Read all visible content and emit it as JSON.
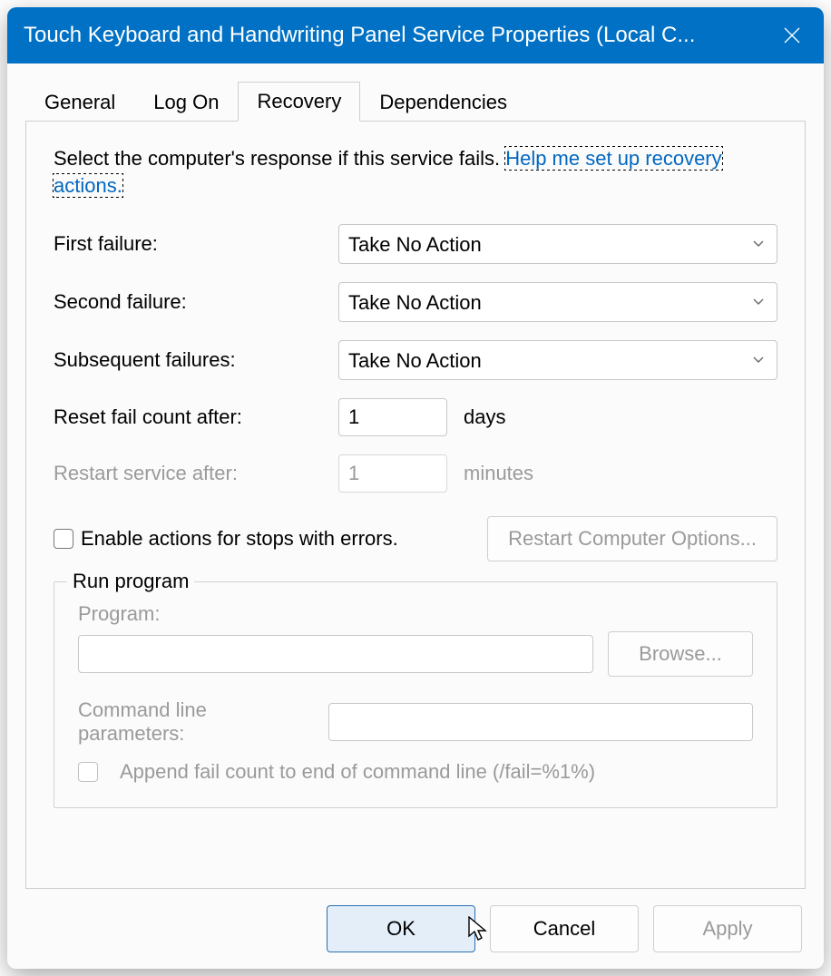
{
  "title": "Touch Keyboard and Handwriting Panel Service Properties (Local C...",
  "tabs": {
    "general": "General",
    "logon": "Log On",
    "recovery": "Recovery",
    "dependencies": "Dependencies"
  },
  "intro": "Select the computer's response if this service fails.",
  "help_link": "Help me set up recovery actions.",
  "labels": {
    "first_failure": "First failure:",
    "second_failure": "Second failure:",
    "subsequent_failures": "Subsequent failures:",
    "reset_after": "Reset fail count after:",
    "restart_after": "Restart service after:",
    "days": "days",
    "minutes": "minutes",
    "enable_actions": "Enable actions for stops with errors.",
    "restart_options": "Restart Computer Options...",
    "run_program": "Run program",
    "program": "Program:",
    "browse": "Browse...",
    "cmd_params": "Command line parameters:",
    "append": "Append fail count to end of command line (/fail=%1%)"
  },
  "selects": {
    "first": "Take No Action",
    "second": "Take No Action",
    "subsequent": "Take No Action"
  },
  "values": {
    "reset_days": "1",
    "restart_minutes": "1",
    "program_path": "",
    "cmd_params": ""
  },
  "buttons": {
    "ok": "OK",
    "cancel": "Cancel",
    "apply": "Apply"
  }
}
